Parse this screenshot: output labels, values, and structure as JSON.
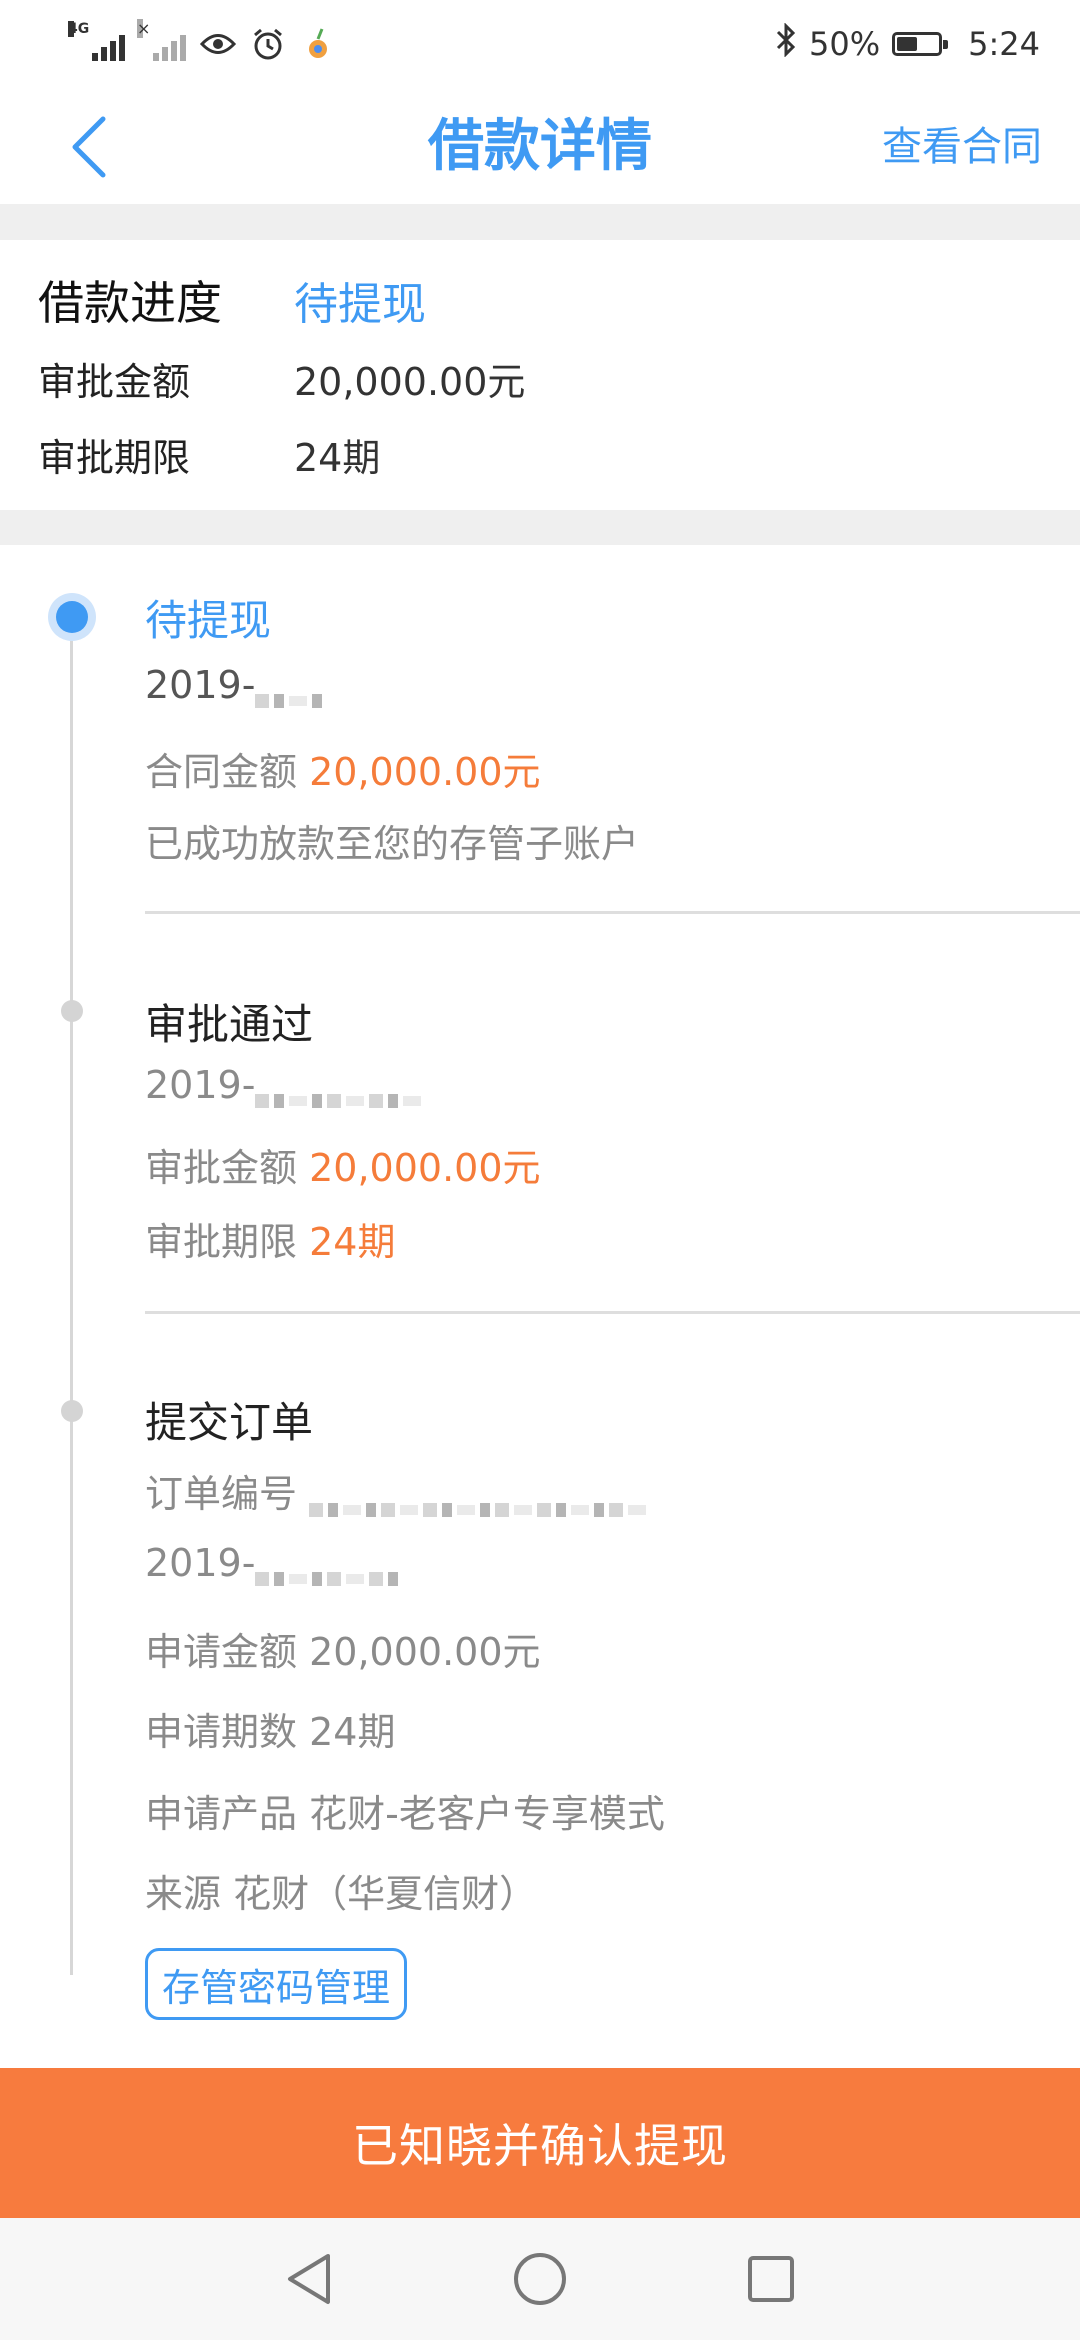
{
  "status_bar": {
    "network_label": "4G",
    "battery": "50%",
    "battery_level": 0.5,
    "time": "5:24"
  },
  "navbar": {
    "title": "借款详情",
    "action": "查看合同"
  },
  "summary": {
    "progress_label": "借款进度",
    "progress_value": "待提现",
    "amount_label": "审批金额",
    "amount_value": "20,000.00元",
    "term_label": "审批期限",
    "term_value": "24期"
  },
  "timeline": {
    "step1": {
      "title": "待提现",
      "date_prefix": "2019-",
      "amount_label": "合同金额",
      "amount_value": "20,000.00元",
      "note": "已成功放款至您的存管子账户"
    },
    "step2": {
      "title": "审批通过",
      "date_prefix": "2019-",
      "amount_label": "审批金额",
      "amount_value": "20,000.00元",
      "term_label": "审批期限",
      "term_value": "24期"
    },
    "step3": {
      "title": "提交订单",
      "order_label": "订单编号",
      "date_prefix": "2019-",
      "apply_amount_label": "申请金额",
      "apply_amount_value": "20,000.00元",
      "apply_term_label": "申请期数",
      "apply_term_value": "24期",
      "product_label": "申请产品",
      "product_value": "花财-老客户专享模式",
      "source_label": "来源",
      "source_value": "花财（华夏信财）"
    }
  },
  "buttons": {
    "password_manage": "存管密码管理",
    "confirm_withdraw": "已知晓并确认提现"
  },
  "colors": {
    "accent_blue": "#3f9af3",
    "accent_orange": "#f57c3a",
    "confirm_bg": "#f77b3e"
  },
  "icons": [
    "signal-icon",
    "eye-icon",
    "alarm-icon",
    "app-icon",
    "bluetooth-icon",
    "battery-icon",
    "back-arrow-icon",
    "nav-back-icon",
    "nav-home-icon",
    "nav-recents-icon"
  ]
}
